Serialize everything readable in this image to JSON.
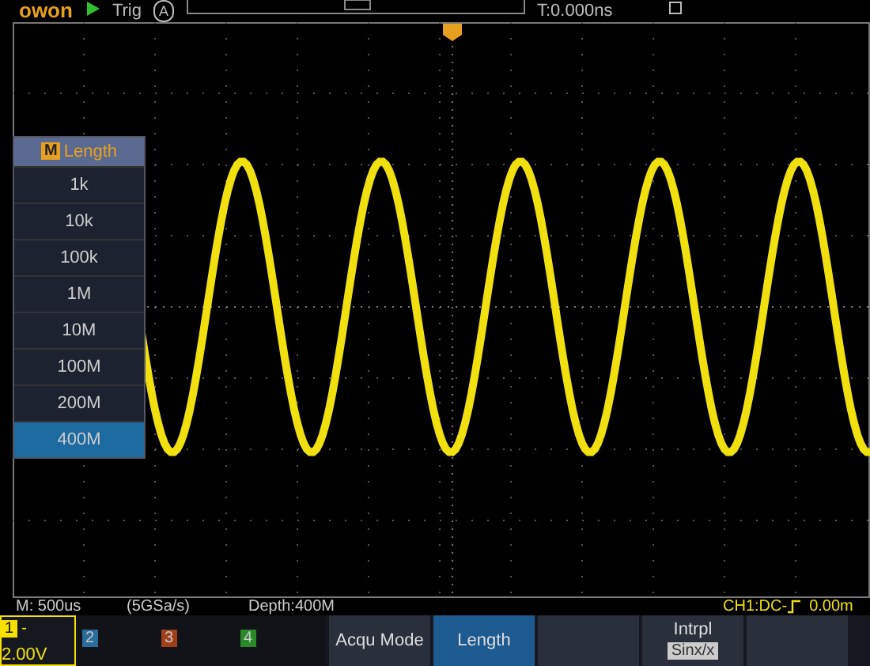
{
  "top_bar": {
    "logo": "owon",
    "trigger_status": "Trig",
    "trigger_mode": "A",
    "time_offset": "T:0.000ns"
  },
  "menu": {
    "badge": "M",
    "title": "Length",
    "items": [
      {
        "label": "1k",
        "selected": false
      },
      {
        "label": "10k",
        "selected": false
      },
      {
        "label": "100k",
        "selected": false
      },
      {
        "label": "1M",
        "selected": false
      },
      {
        "label": "10M",
        "selected": false
      },
      {
        "label": "100M",
        "selected": false
      },
      {
        "label": "200M",
        "selected": false
      },
      {
        "label": "400M",
        "selected": true
      }
    ]
  },
  "info_bar": {
    "timebase": "M: 500us",
    "sample_rate": "(5GSa/s)",
    "depth": "Depth:400M",
    "trigger": "CH1:DC-",
    "trigger_level": "0.00m"
  },
  "channels": [
    {
      "number": "1",
      "coupling": "-",
      "scale": "2.00V",
      "active": true,
      "color": "#f5e000"
    },
    {
      "number": "2",
      "active": false,
      "color": "#2a6d9a"
    },
    {
      "number": "3",
      "active": false,
      "color": "#a0401a"
    },
    {
      "number": "4",
      "active": false,
      "color": "#2a8a2a"
    }
  ],
  "softkeys": [
    {
      "kind": "label",
      "label": "Acqu Mode",
      "selected": false
    },
    {
      "kind": "label",
      "label": "Length",
      "selected": true
    },
    {
      "kind": "blank"
    },
    {
      "kind": "option",
      "label": "Intrpl",
      "value": "Sinx/x"
    },
    {
      "kind": "blank"
    }
  ]
}
